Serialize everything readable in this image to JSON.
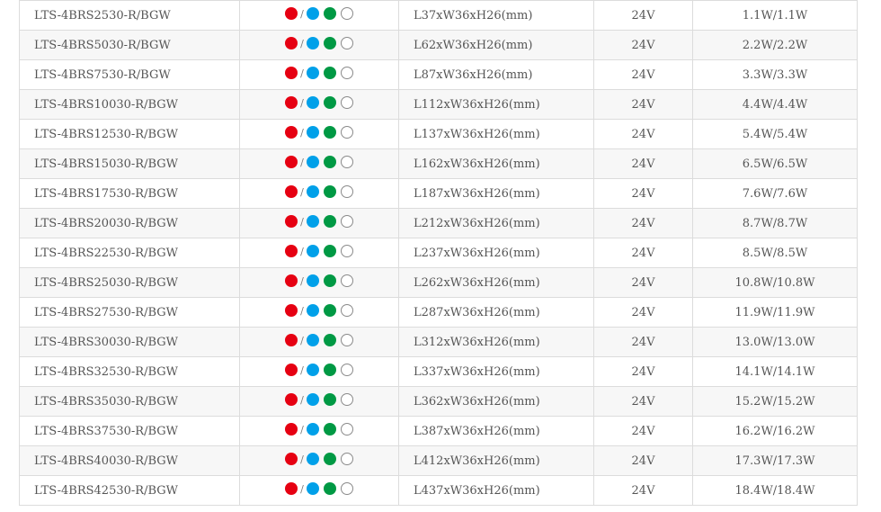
{
  "colors": {
    "red": "#e60012",
    "blue": "#00a0e9",
    "green": "#009944",
    "white": "#ffffff"
  },
  "separator": "/",
  "rows": [
    {
      "model": "LTS-4BRS2530-R/BGW",
      "size": "L37xW36xH26(mm)",
      "voltage": "24V",
      "power": "1.1W/1.1W"
    },
    {
      "model": "LTS-4BRS5030-R/BGW",
      "size": "L62xW36xH26(mm)",
      "voltage": "24V",
      "power": "2.2W/2.2W"
    },
    {
      "model": "LTS-4BRS7530-R/BGW",
      "size": "L87xW36xH26(mm)",
      "voltage": "24V",
      "power": "3.3W/3.3W"
    },
    {
      "model": "LTS-4BRS10030-R/BGW",
      "size": "L112xW36xH26(mm)",
      "voltage": "24V",
      "power": "4.4W/4.4W"
    },
    {
      "model": "LTS-4BRS12530-R/BGW",
      "size": "L137xW36xH26(mm)",
      "voltage": "24V",
      "power": "5.4W/5.4W"
    },
    {
      "model": "LTS-4BRS15030-R/BGW",
      "size": "L162xW36xH26(mm)",
      "voltage": "24V",
      "power": "6.5W/6.5W"
    },
    {
      "model": "LTS-4BRS17530-R/BGW",
      "size": "L187xW36xH26(mm)",
      "voltage": "24V",
      "power": "7.6W/7.6W"
    },
    {
      "model": "LTS-4BRS20030-R/BGW",
      "size": "L212xW36xH26(mm)",
      "voltage": "24V",
      "power": "8.7W/8.7W"
    },
    {
      "model": "LTS-4BRS22530-R/BGW",
      "size": "L237xW36xH26(mm)",
      "voltage": "24V",
      "power": "8.5W/8.5W"
    },
    {
      "model": "LTS-4BRS25030-R/BGW",
      "size": "L262xW36xH26(mm)",
      "voltage": "24V",
      "power": "10.8W/10.8W"
    },
    {
      "model": "LTS-4BRS27530-R/BGW",
      "size": "L287xW36xH26(mm)",
      "voltage": "24V",
      "power": "11.9W/11.9W"
    },
    {
      "model": "LTS-4BRS30030-R/BGW",
      "size": "L312xW36xH26(mm)",
      "voltage": "24V",
      "power": "13.0W/13.0W"
    },
    {
      "model": "LTS-4BRS32530-R/BGW",
      "size": "L337xW36xH26(mm)",
      "voltage": "24V",
      "power": "14.1W/14.1W"
    },
    {
      "model": "LTS-4BRS35030-R/BGW",
      "size": "L362xW36xH26(mm)",
      "voltage": "24V",
      "power": "15.2W/15.2W"
    },
    {
      "model": "LTS-4BRS37530-R/BGW",
      "size": "L387xW36xH26(mm)",
      "voltage": "24V",
      "power": "16.2W/16.2W"
    },
    {
      "model": "LTS-4BRS40030-R/BGW",
      "size": "L412xW36xH26(mm)",
      "voltage": "24V",
      "power": "17.3W/17.3W"
    },
    {
      "model": "LTS-4BRS42530-R/BGW",
      "size": "L437xW36xH26(mm)",
      "voltage": "24V",
      "power": "18.4W/18.4W"
    }
  ]
}
